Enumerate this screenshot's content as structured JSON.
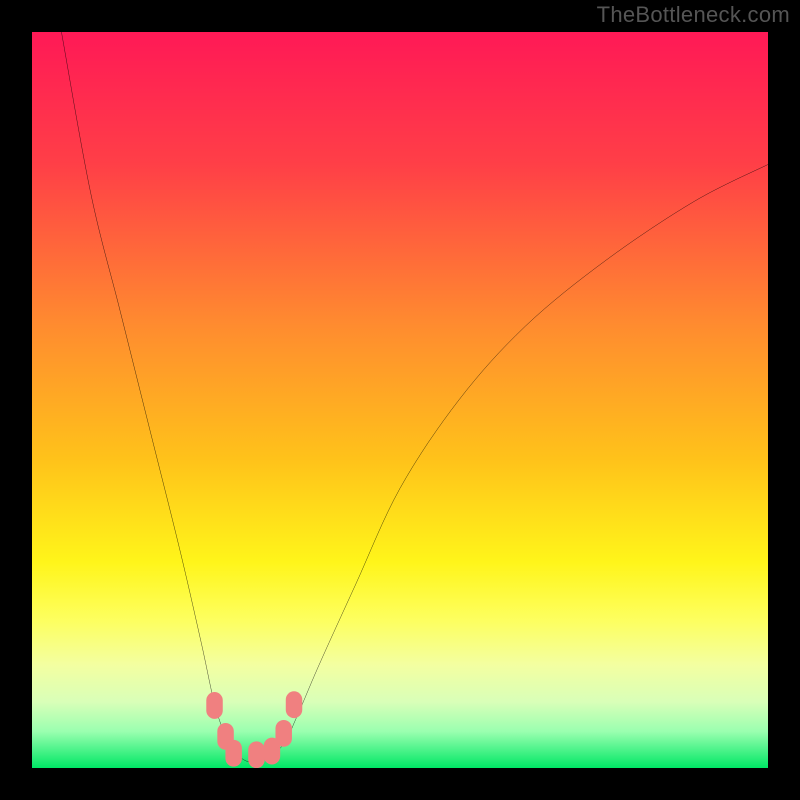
{
  "watermark": "TheBottleneck.com",
  "chart_data": {
    "type": "line",
    "title": "",
    "xlabel": "",
    "ylabel": "",
    "xlim": [
      0,
      100
    ],
    "ylim": [
      0,
      100
    ],
    "gradient_stops": [
      {
        "offset": 0,
        "color": "#ff1956"
      },
      {
        "offset": 18,
        "color": "#ff3f47"
      },
      {
        "offset": 40,
        "color": "#ff8c2f"
      },
      {
        "offset": 58,
        "color": "#ffc21a"
      },
      {
        "offset": 72,
        "color": "#fff51a"
      },
      {
        "offset": 80,
        "color": "#fdff60"
      },
      {
        "offset": 86,
        "color": "#f3ffa1"
      },
      {
        "offset": 91,
        "color": "#d9ffb8"
      },
      {
        "offset": 95,
        "color": "#9bffb0"
      },
      {
        "offset": 100,
        "color": "#00e765"
      }
    ],
    "curve": {
      "x": [
        4,
        8,
        12,
        16,
        20,
        23,
        25,
        27,
        29,
        31,
        34,
        36,
        39,
        44,
        50,
        58,
        67,
        78,
        90,
        100
      ],
      "y": [
        100,
        78,
        62,
        46,
        30,
        17,
        8,
        3,
        1,
        1,
        3,
        7,
        14,
        25,
        38,
        50,
        60,
        69,
        77,
        82
      ]
    },
    "markers": [
      {
        "x": 24.8,
        "y": 8.5
      },
      {
        "x": 26.3,
        "y": 4.3
      },
      {
        "x": 27.4,
        "y": 2.0
      },
      {
        "x": 30.5,
        "y": 1.8
      },
      {
        "x": 32.6,
        "y": 2.3
      },
      {
        "x": 34.2,
        "y": 4.7
      },
      {
        "x": 35.6,
        "y": 8.6
      }
    ],
    "marker_color": "#f08080",
    "marker_radius": 1.4
  }
}
